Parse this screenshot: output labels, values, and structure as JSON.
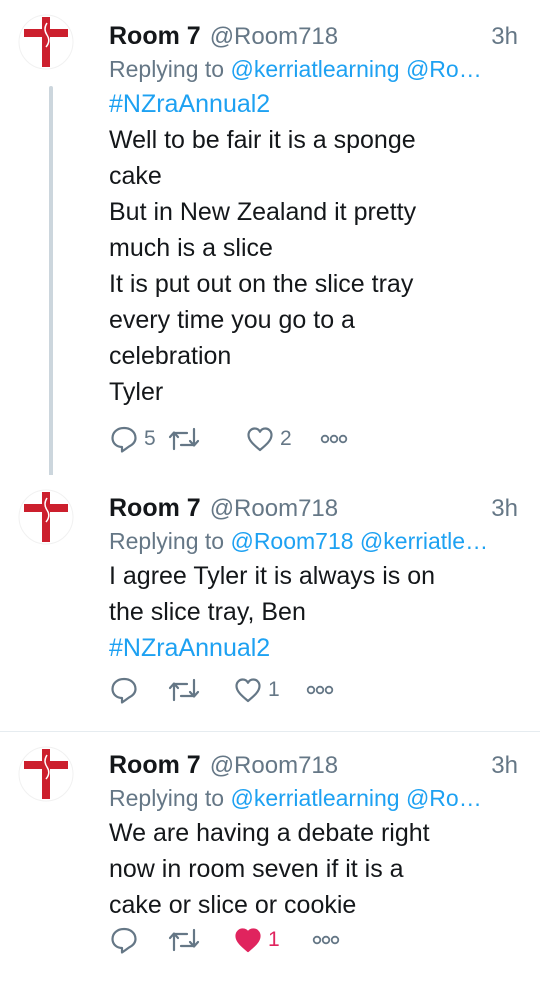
{
  "tweets": [
    {
      "name": "Room 7",
      "handle": "@Room718",
      "time": "3h",
      "replying_prefix": "Replying to ",
      "replying_to": "@kerriatlearning @Ro…",
      "hashtag_top": "#NZraAnnual2",
      "body": "Well to be fair it is a sponge\ncake\nBut in New Zealand it pretty\nmuch is a slice\nIt is put out on the slice tray\nevery time you go to a\ncelebration\nTyler",
      "hashtag_bottom": "",
      "reply_count": "5",
      "retweet_count": "",
      "like_count": "2",
      "liked": false
    },
    {
      "name": "Room 7",
      "handle": "@Room718",
      "time": "3h",
      "replying_prefix": "Replying to ",
      "replying_to": "@Room718 @kerriatle…",
      "hashtag_top": "",
      "body": "I agree Tyler it is always is on\nthe slice tray, Ben",
      "hashtag_bottom": "#NZraAnnual2",
      "reply_count": "",
      "retweet_count": "",
      "like_count": "1",
      "liked": false
    },
    {
      "name": "Room 7",
      "handle": "@Room718",
      "time": "3h",
      "replying_prefix": "Replying to ",
      "replying_to": "@kerriatlearning @Ro…",
      "hashtag_top": "",
      "body": "We are having a debate right\nnow in room seven if it is a\ncake or slice or cookie",
      "hashtag_bottom": "",
      "reply_count": "",
      "retweet_count": "",
      "like_count": "1",
      "liked": true
    }
  ],
  "colors": {
    "accent": "#1da1f2",
    "muted": "#657786",
    "like_active": "#e0245e",
    "avatar_cross": "#cc1f2d"
  },
  "icons": [
    "cross-avatar-icon",
    "reply-icon",
    "retweet-icon",
    "heart-icon",
    "more-icon"
  ]
}
